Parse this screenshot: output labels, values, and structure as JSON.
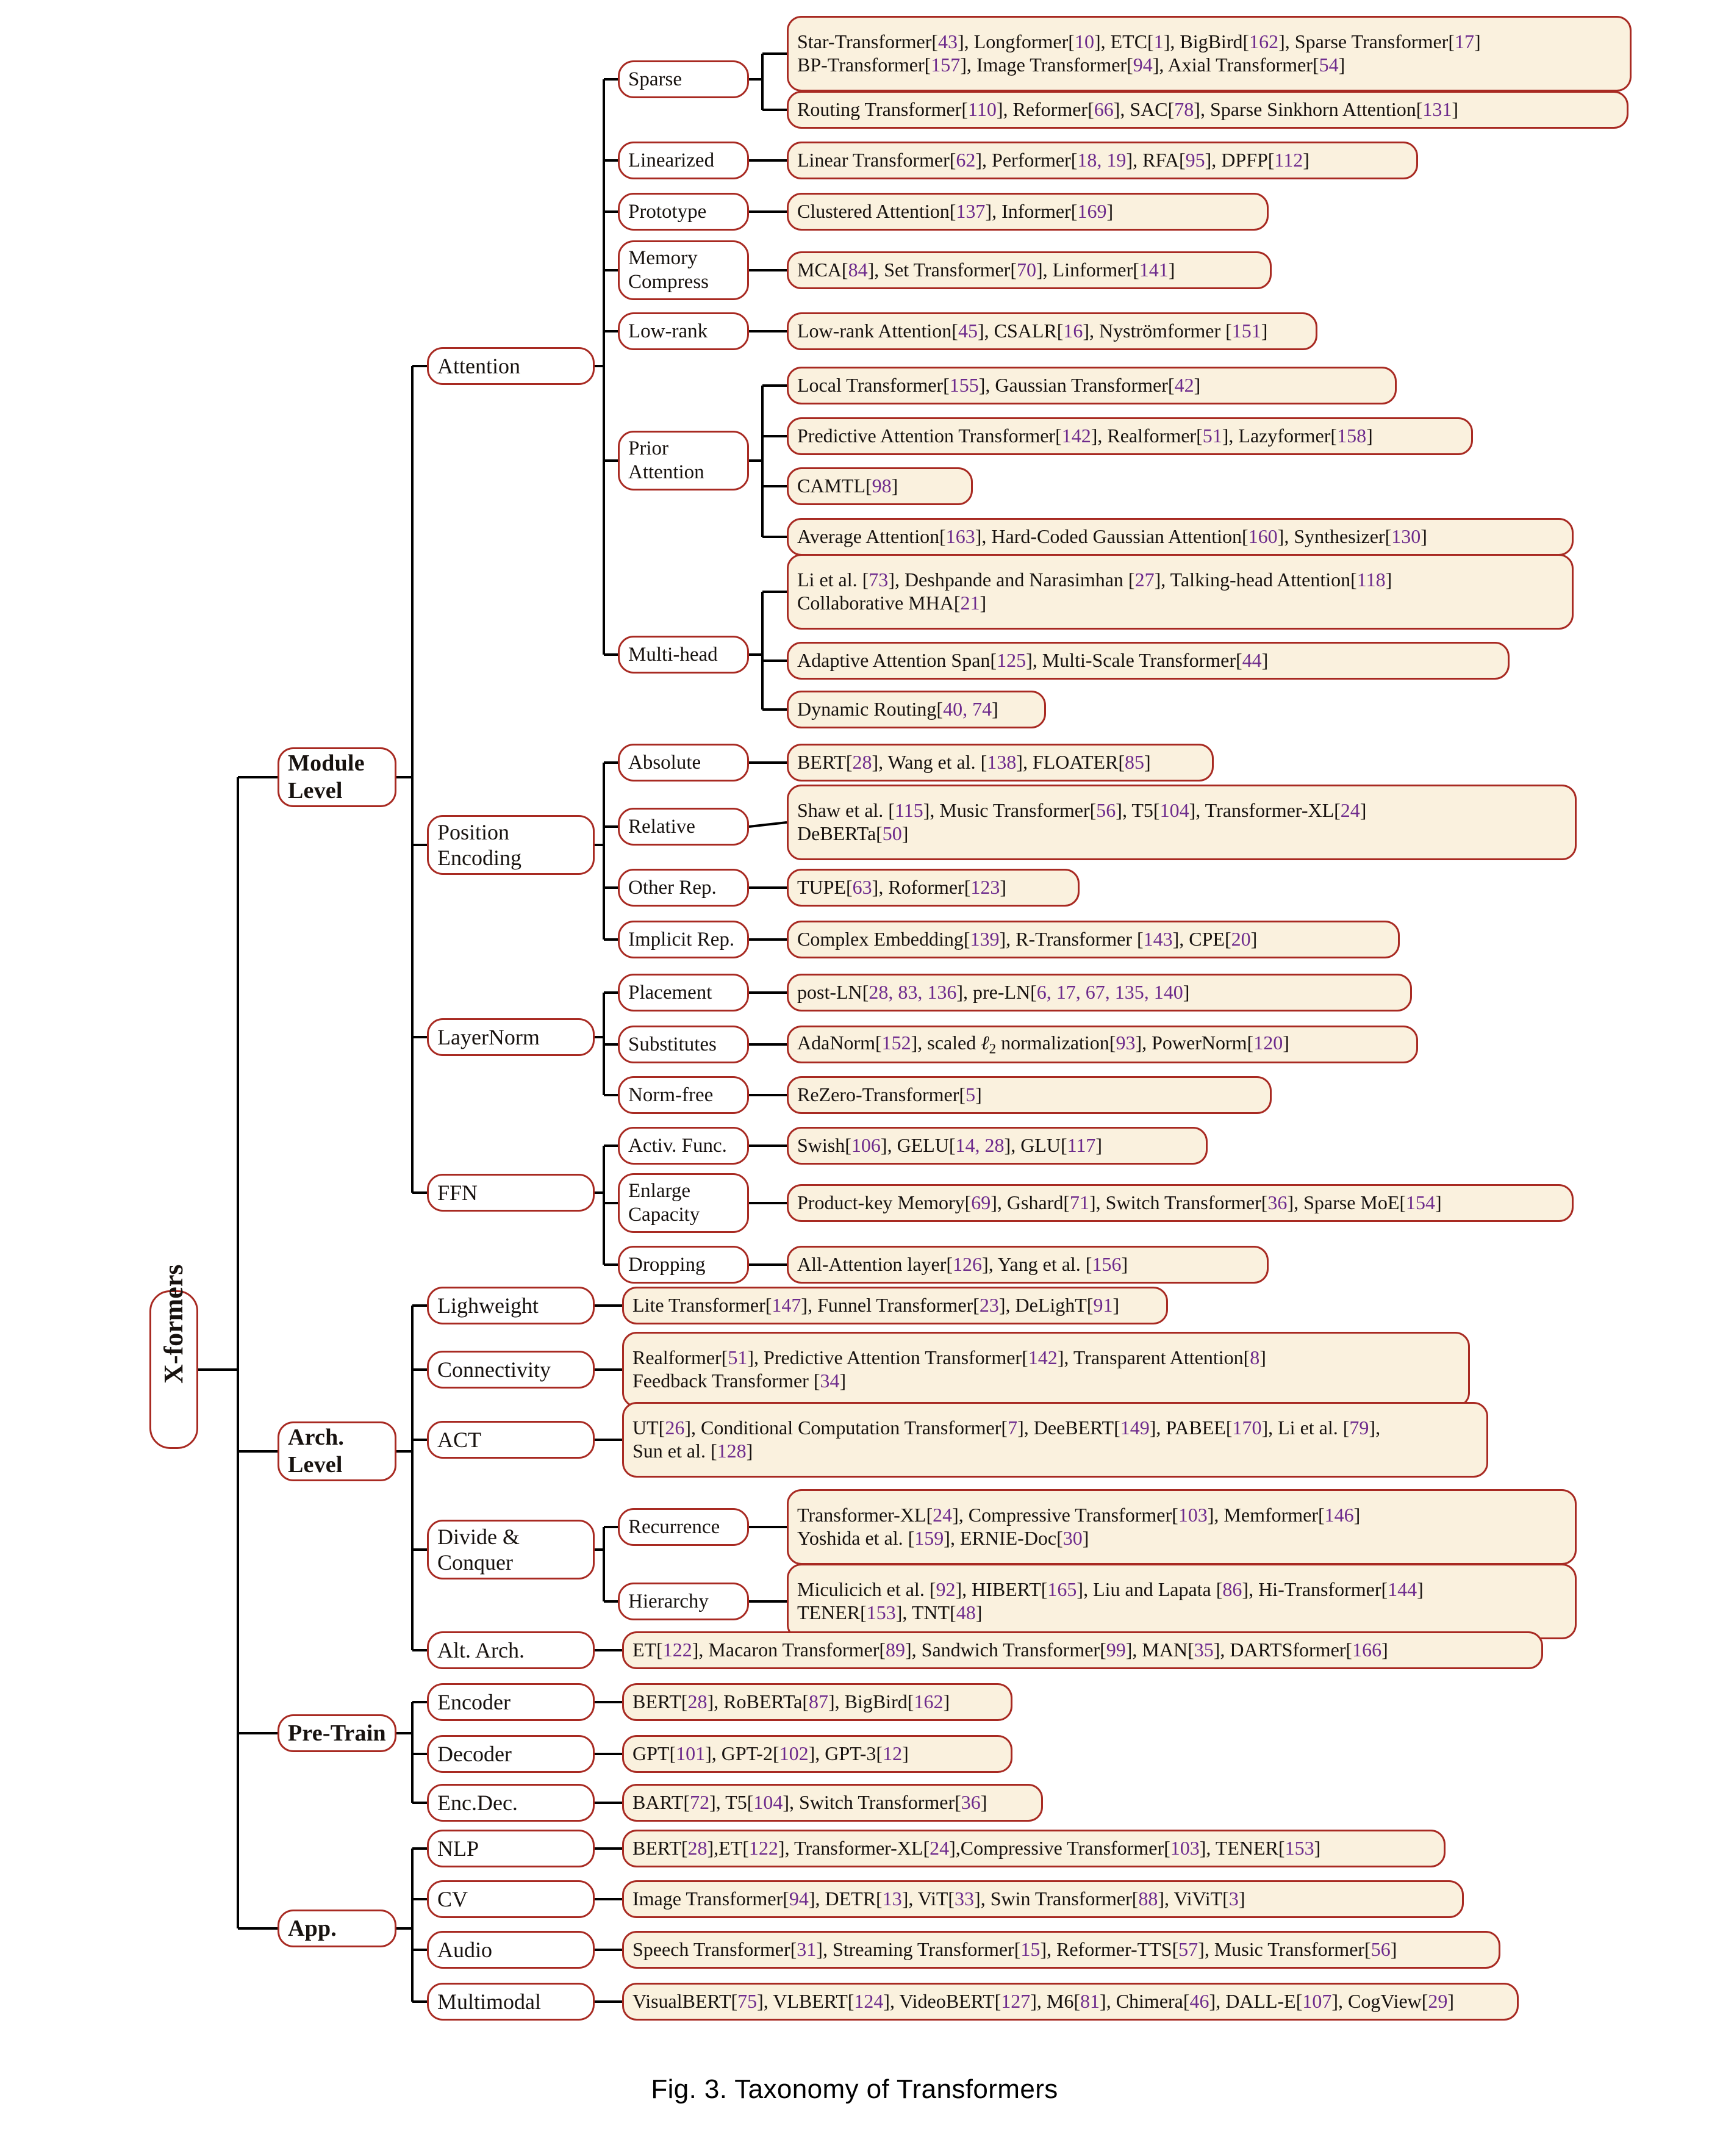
{
  "figure": {
    "caption": "Fig. 3.  Taxonomy of Transformers"
  },
  "colors": {
    "border": "#a82a22",
    "leaf_fill": "#faf1de",
    "citation": "#6d2a8c",
    "wire": "#000000",
    "node_fill": "#ffffff"
  },
  "root": {
    "label": "X-formers"
  },
  "level1": [
    {
      "label": "Module\nLevel"
    },
    {
      "label": "Arch.\nLevel"
    },
    {
      "label": "Pre-Train"
    },
    {
      "label": "App."
    }
  ],
  "level2": [
    {
      "label": "Attention"
    },
    {
      "label": "Position\nEncoding"
    },
    {
      "label": "LayerNorm"
    },
    {
      "label": "FFN"
    },
    {
      "label": "Lighweight"
    },
    {
      "label": "Connectivity"
    },
    {
      "label": "ACT"
    },
    {
      "label": "Divide &\nConquer"
    },
    {
      "label": "Alt. Arch."
    },
    {
      "label": "Encoder"
    },
    {
      "label": "Decoder"
    },
    {
      "label": "Enc.Dec."
    },
    {
      "label": "NLP"
    },
    {
      "label": "CV"
    },
    {
      "label": "Audio"
    },
    {
      "label": "Multimodal"
    }
  ],
  "level3": [
    {
      "label": "Sparse"
    },
    {
      "label": "Linearized"
    },
    {
      "label": "Prototype"
    },
    {
      "label": "Memory\nCompress"
    },
    {
      "label": "Low-rank"
    },
    {
      "label": "Prior\nAttention"
    },
    {
      "label": "Multi-head"
    },
    {
      "label": "Absolute"
    },
    {
      "label": "Relative"
    },
    {
      "label": "Other Rep."
    },
    {
      "label": "Implicit Rep."
    },
    {
      "label": "Placement"
    },
    {
      "label": "Substitutes"
    },
    {
      "label": "Norm-free"
    },
    {
      "label": "Activ. Func."
    },
    {
      "label": "Enlarge\nCapacity"
    },
    {
      "label": "Dropping"
    },
    {
      "label": "Recurrence"
    },
    {
      "label": "Hierarchy"
    }
  ],
  "leaves": [
    {
      "id": "sparse-a",
      "html": "Star-Transformer[<c>43</c>], Longformer[<c>10</c>], ETC[<c>1</c>], BigBird[<c>162</c>], Sparse Transformer[<c>17</c>]<br>BP-Transformer[<c>157</c>], Image Transformer[<c>94</c>], Axial Transformer[<c>54</c>]"
    },
    {
      "id": "sparse-b",
      "html": "Routing Transformer[<c>110</c>], Reformer[<c>66</c>], SAC[<c>78</c>], Sparse Sinkhorn Attention[<c>131</c>]"
    },
    {
      "id": "linearized",
      "html": "Linear Transformer[<c>62</c>], Performer[<c>18, 19</c>], RFA[<c>95</c>], DPFP[<c>112</c>]"
    },
    {
      "id": "prototype",
      "html": "Clustered Attention[<c>137</c>], Informer[<c>169</c>]"
    },
    {
      "id": "memory-compress",
      "html": "MCA[<c>84</c>], Set Transformer[<c>70</c>], Linformer[<c>141</c>]"
    },
    {
      "id": "low-rank",
      "html": "Low-rank Attention[<c>45</c>], CSALR[<c>16</c>], Nystr&ouml;mformer [<c>151</c>]"
    },
    {
      "id": "prior-a",
      "html": "Local Transformer[<c>155</c>], Gaussian Transformer[<c>42</c>]"
    },
    {
      "id": "prior-b",
      "html": "Predictive Attention Transformer[<c>142</c>], Realformer[<c>51</c>], Lazyformer[<c>158</c>]"
    },
    {
      "id": "prior-c",
      "html": "CAMTL[<c>98</c>]"
    },
    {
      "id": "prior-d",
      "html": "Average Attention[<c>163</c>], Hard-Coded Gaussian Attention[<c>160</c>], Synthesizer[<c>130</c>]"
    },
    {
      "id": "multihead-a",
      "html": "Li et al. [<c>73</c>], Deshpande and Narasimhan [<c>27</c>], Talking-head Attention[<c>118</c>]<br>Collaborative MHA[<c>21</c>]"
    },
    {
      "id": "multihead-b",
      "html": "Adaptive Attention Span[<c>125</c>], Multi-Scale Transformer[<c>44</c>]"
    },
    {
      "id": "multihead-c",
      "html": "Dynamic Routing[<c>40, 74</c>]"
    },
    {
      "id": "absolute",
      "html": "BERT[<c>28</c>], Wang et al. [<c>138</c>], FLOATER[<c>85</c>]"
    },
    {
      "id": "relative",
      "html": "Shaw et al. [<c>115</c>], Music Transformer[<c>56</c>], T5[<c>104</c>], Transformer-XL[<c>24</c>]<br>DeBERTa[<c>50</c>]"
    },
    {
      "id": "other-rep",
      "html": "TUPE[<c>63</c>], Roformer[<c>123</c>]"
    },
    {
      "id": "implicit-rep",
      "html": "Complex Embedding[<c>139</c>], R-Transformer [<c>143</c>], CPE[<c>20</c>]"
    },
    {
      "id": "placement",
      "html": "post-LN[<c>28, 83, 136</c>], pre-LN[<c>6, 17, 67, 135, 140</c>]"
    },
    {
      "id": "substitutes",
      "html": "AdaNorm[<c>152</c>], scaled <i>&#8467;</i><sub class=\"sub\">2</sub> normalization[<c>93</c>], PowerNorm[<c>120</c>]"
    },
    {
      "id": "norm-free",
      "html": "ReZero-Transformer[<c>5</c>]"
    },
    {
      "id": "activ-func",
      "html": "Swish[<c>106</c>], GELU[<c>14, 28</c>], GLU[<c>117</c>]"
    },
    {
      "id": "enlarge-capacity",
      "html": "Product-key Memory[<c>69</c>], Gshard[<c>71</c>], Switch Transformer[<c>36</c>], Sparse MoE[<c>154</c>]"
    },
    {
      "id": "dropping",
      "html": "All-Attention layer[<c>126</c>], Yang et al. [<c>156</c>]"
    },
    {
      "id": "lighweight",
      "html": "Lite Transformer[<c>147</c>], Funnel Transformer[<c>23</c>], DeLighT[<c>91</c>]"
    },
    {
      "id": "connectivity",
      "html": "Realformer[<c>51</c>], Predictive Attention Transformer[<c>142</c>], Transparent Attention[<c>8</c>]<br>Feedback Transformer [<c>34</c>]"
    },
    {
      "id": "act",
      "html": "UT[<c>26</c>], Conditional Computation Transformer[<c>7</c>], DeeBERT[<c>149</c>], PABEE[<c>170</c>], Li et al. [<c>79</c>],<br>Sun et al. [<c>128</c>]"
    },
    {
      "id": "recurrence",
      "html": "Transformer-XL[<c>24</c>], Compressive Transformer[<c>103</c>], Memformer[<c>146</c>]<br>Yoshida et al. [<c>159</c>], ERNIE-Doc[<c>30</c>]"
    },
    {
      "id": "hierarchy",
      "html": "Miculicich et al. [<c>92</c>], HIBERT[<c>165</c>], Liu and Lapata [<c>86</c>], Hi-Transformer[<c>144</c>]<br>TENER[<c>153</c>], TNT[<c>48</c>]"
    },
    {
      "id": "alt-arch",
      "html": "ET[<c>122</c>], Macaron Transformer[<c>89</c>], Sandwich Transformer[<c>99</c>], MAN[<c>35</c>], DARTSformer[<c>166</c>]"
    },
    {
      "id": "encoder",
      "html": "BERT[<c>28</c>], RoBERTa[<c>87</c>], BigBird[<c>162</c>]"
    },
    {
      "id": "decoder",
      "html": "GPT[<c>101</c>], GPT-2[<c>102</c>], GPT-3[<c>12</c>]"
    },
    {
      "id": "enc-dec",
      "html": "BART[<c>72</c>], T5[<c>104</c>], Switch Transformer[<c>36</c>]"
    },
    {
      "id": "nlp",
      "html": "BERT[<c>28</c>],ET[<c>122</c>], Transformer-XL[<c>24</c>],Compressive Transformer[<c>103</c>], TENER[<c>153</c>]"
    },
    {
      "id": "cv",
      "html": "Image Transformer[<c>94</c>], DETR[<c>13</c>], ViT[<c>33</c>], Swin Transformer[<c>88</c>], ViViT[<c>3</c>]"
    },
    {
      "id": "audio",
      "html": "Speech Transformer[<c>31</c>], Streaming Transformer[<c>15</c>], Reformer-TTS[<c>57</c>], Music Transformer[<c>56</c>]"
    },
    {
      "id": "multimodal",
      "html": "VisualBERT[<c>75</c>], VLBERT[<c>124</c>], VideoBERT[<c>127</c>], M6[<c>81</c>], Chimera[<c>46</c>], DALL-E[<c>107</c>], CogView[<c>29</c>]"
    }
  ]
}
